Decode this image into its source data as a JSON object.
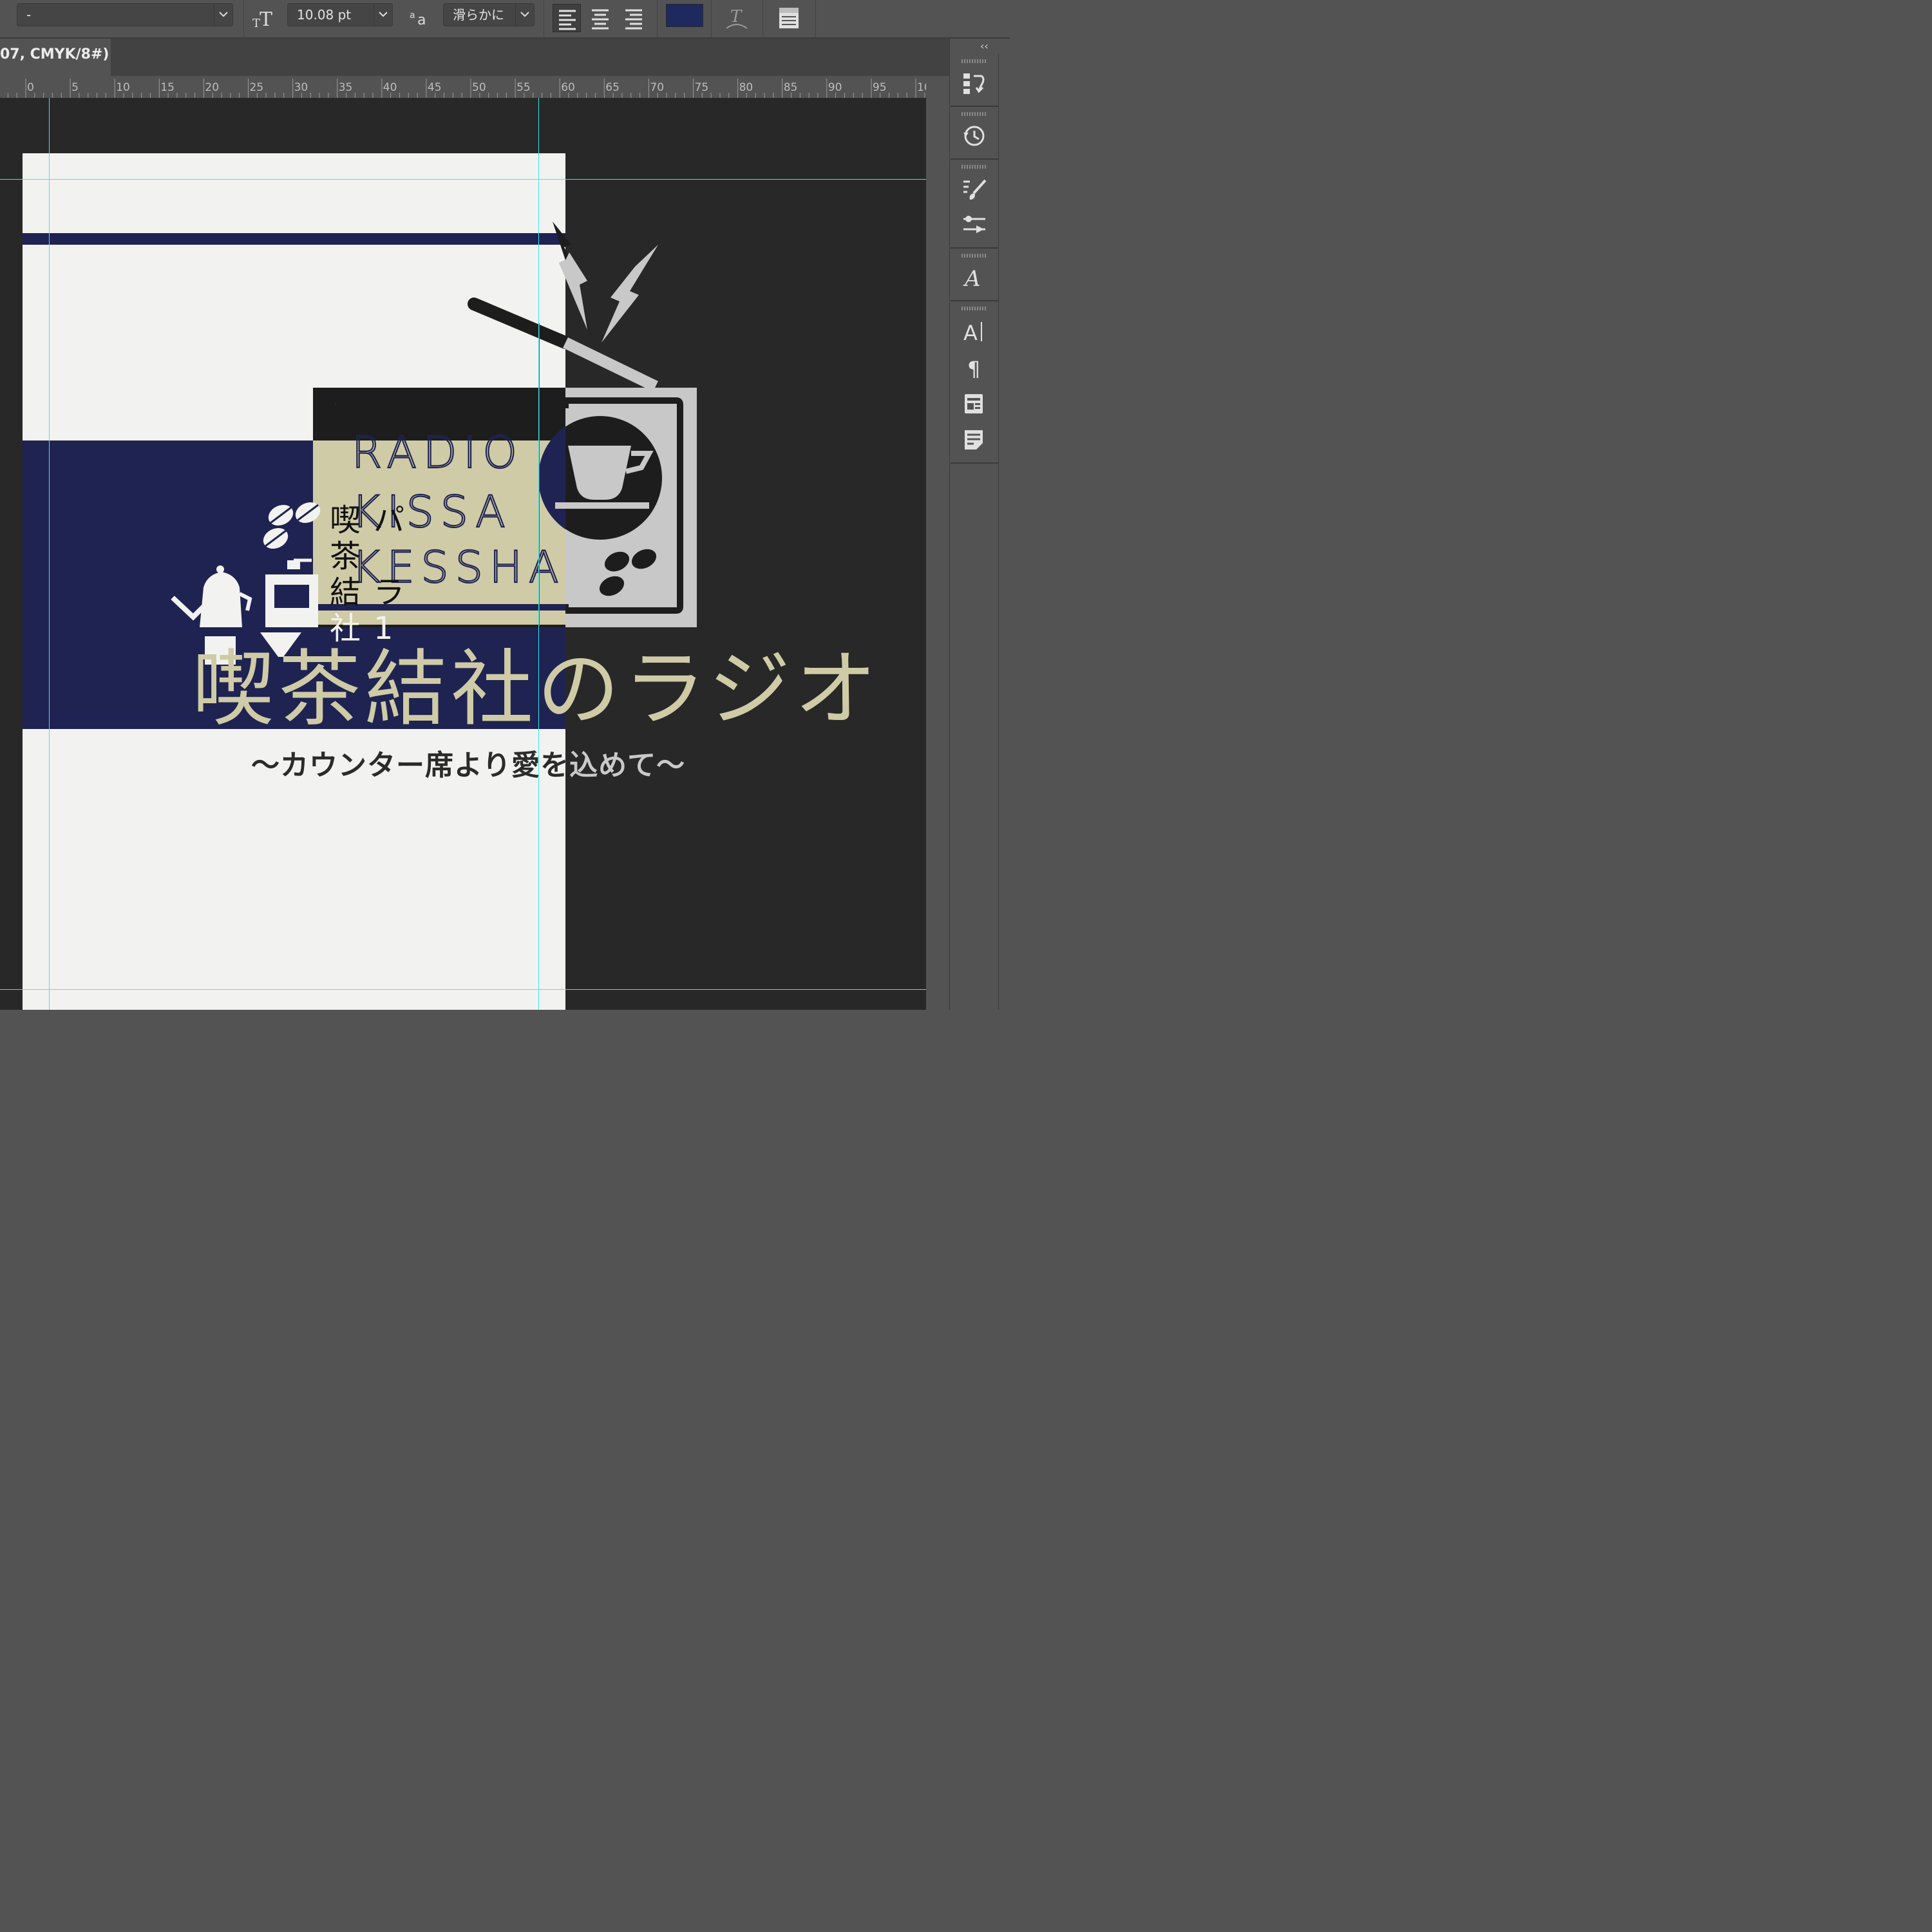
{
  "options_bar": {
    "font_style_value": "-",
    "font_size_value": "10.08 pt",
    "anti_alias_value": "滑らかに",
    "text_color": "#1e2a5e"
  },
  "document_tab": {
    "title": "07, CMYK/8#)"
  },
  "ruler": {
    "labels": [
      "0",
      "5",
      "10",
      "15",
      "20",
      "25",
      "30",
      "35",
      "40",
      "45",
      "50",
      "55",
      "60",
      "65",
      "70",
      "75",
      "80",
      "85",
      "90",
      "95",
      "10"
    ]
  },
  "artwork": {
    "radio_lines": [
      "RADIO",
      "KISSA",
      "KESSHA"
    ],
    "vertical_title": [
      "喫",
      "茶",
      "結",
      "社"
    ],
    "vertical_kana": [
      "パ",
      "ラ",
      "1"
    ],
    "main_title": "喫茶結社のラジオ",
    "subtitle": "～カウンター席より愛を込めて～",
    "colors": {
      "navy": "#1f2352",
      "paper": "#f2f2f0",
      "beige": "#cfcba6",
      "grey": "#c8c8c8"
    }
  }
}
